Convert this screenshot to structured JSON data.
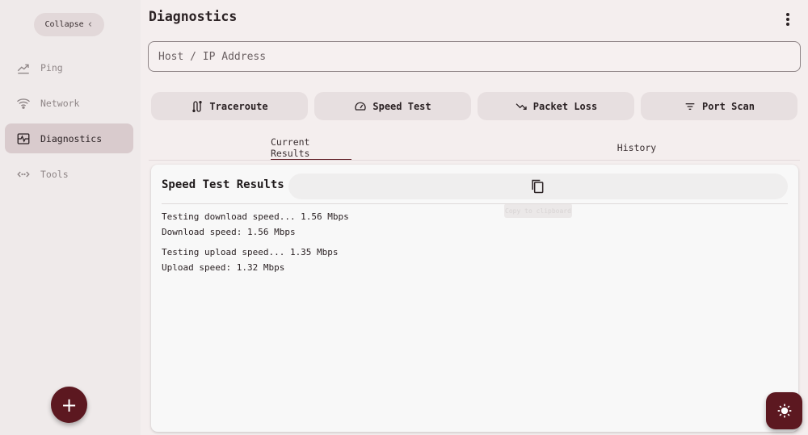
{
  "sidebar": {
    "collapse_label": "Collapse",
    "items": [
      {
        "label": "Ping",
        "icon": "ping-icon"
      },
      {
        "label": "Network",
        "icon": "wifi-icon"
      },
      {
        "label": "Diagnostics",
        "icon": "monitor-heart-icon",
        "active": true
      },
      {
        "label": "Tools",
        "icon": "code-icon"
      }
    ],
    "add_label": "+"
  },
  "header": {
    "title": "Diagnostics"
  },
  "host_input": {
    "placeholder": "Host / IP Address",
    "value": ""
  },
  "actions": [
    {
      "label": "Traceroute",
      "icon": "route-icon"
    },
    {
      "label": "Speed Test",
      "icon": "speedometer-icon"
    },
    {
      "label": "Packet Loss",
      "icon": "trending-down-icon"
    },
    {
      "label": "Port Scan",
      "icon": "filter-icon"
    }
  ],
  "tabs": [
    {
      "label": "Current Results",
      "active": true
    },
    {
      "label": "History",
      "active": false
    }
  ],
  "results": {
    "title": "Speed Test Results",
    "tooltip": "Copy to clipboard",
    "lines": [
      "Testing download speed... 1.56 Mbps",
      "Download speed: 1.56 Mbps",
      "Testing upload speed... 1.35 Mbps",
      "Upload speed: 1.32 Mbps"
    ]
  },
  "colors": {
    "accent": "#5c1820",
    "active_nav": "#d9cbcd",
    "background": "#f4eeee"
  }
}
